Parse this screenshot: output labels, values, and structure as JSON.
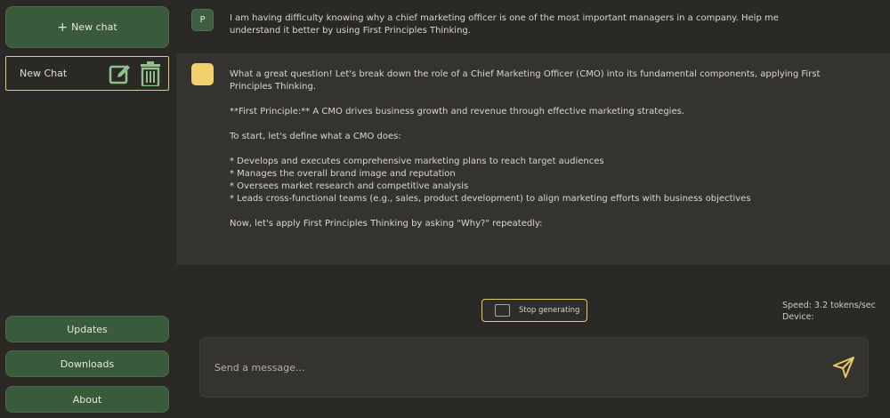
{
  "sidebar": {
    "new_chat_label": "New chat",
    "plus_glyph": "+",
    "chat_items": [
      {
        "label": "New Chat"
      }
    ],
    "updates_label": "Updates",
    "downloads_label": "Downloads",
    "about_label": "About"
  },
  "conversation": {
    "user_avatar_letter": "P",
    "user_message": "I am having difficulty knowing why a chief marketing officer is one of the most important managers in a company. Help me understand it better by using First Principles Thinking.",
    "assistant_message": "What a great question! Let's break down the role of a Chief Marketing Officer (CMO) into its fundamental components, applying First Principles Thinking.\n\n**First Principle:** A CMO drives business growth and revenue through effective marketing strategies.\n\nTo start, let's define what a CMO does:\n\n* Develops and executes comprehensive marketing plans to reach target audiences\n* Manages the overall brand image and reputation\n* Oversees market research and competitive analysis\n* Leads cross-functional teams (e.g., sales, product development) to align marketing efforts with business objectives\n\nNow, let's apply First Principles Thinking by asking \"Why?\" repeatedly:"
  },
  "controls": {
    "stop_label": "Stop generating",
    "speed_text": "Speed: 3.2 tokens/sec",
    "device_text": "Device:"
  },
  "input": {
    "placeholder": "Send a message...",
    "value": ""
  },
  "colors": {
    "accent_green": "#3a5a3c",
    "accent_yellow": "#e6c96a",
    "bot_avatar": "#f2d06b"
  },
  "icons": {
    "edit": "edit-icon",
    "delete": "trash-icon",
    "send": "send-icon",
    "stop": "stop-icon"
  }
}
